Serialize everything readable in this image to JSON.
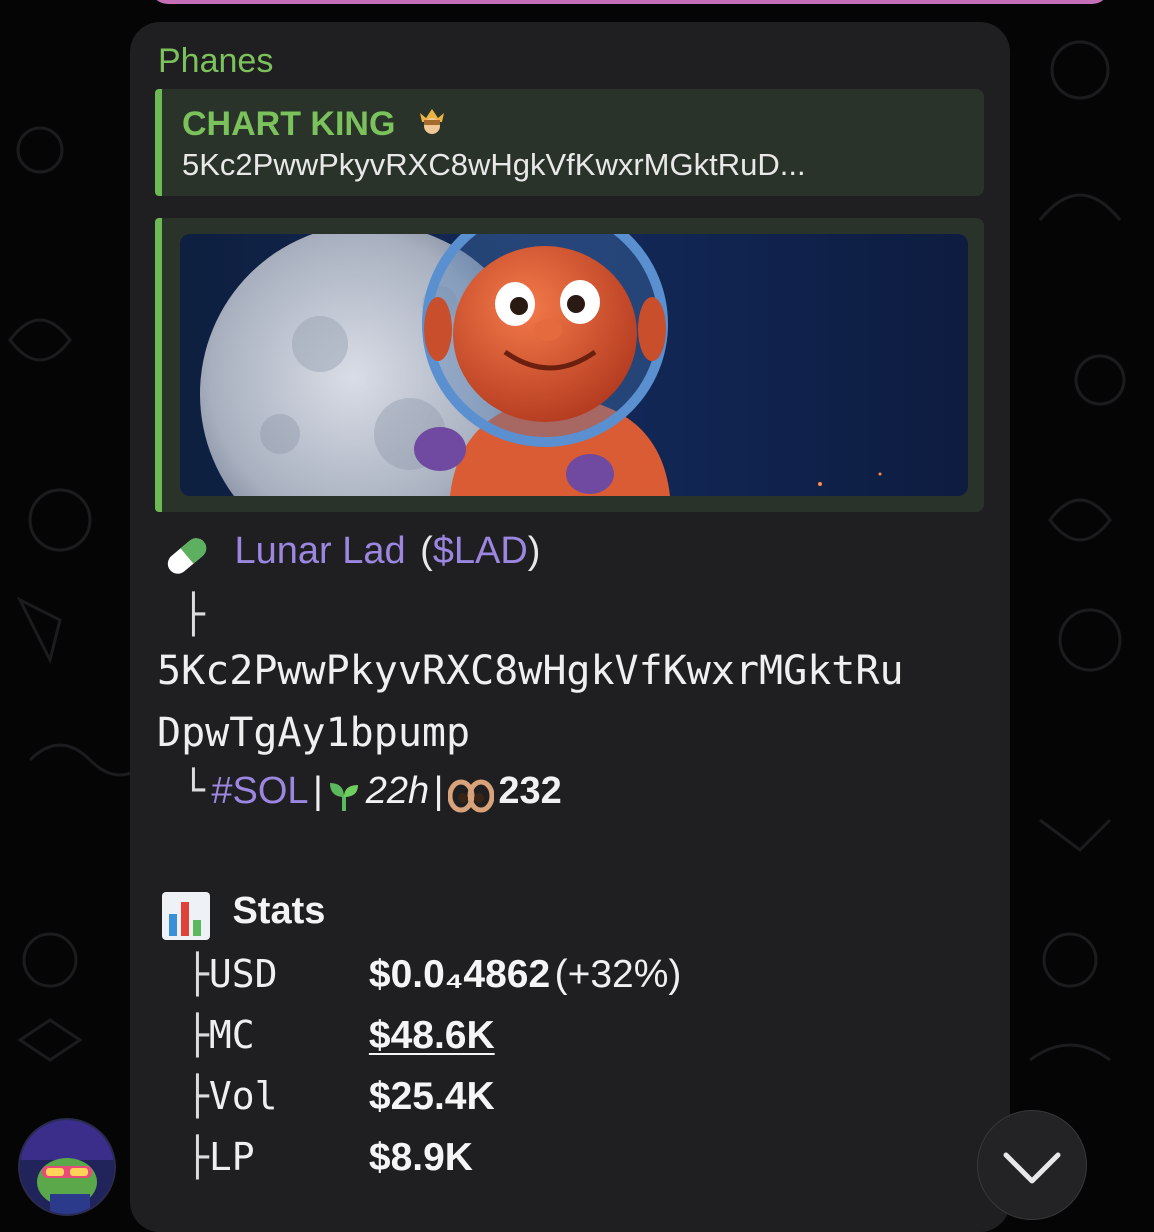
{
  "message": {
    "sender": "Phanes",
    "reply": {
      "title": "CHART KING",
      "text": "5Kc2PwwPkyvRXC8wHgkVfKwxrMGktRuD..."
    },
    "token": {
      "name": "Lunar Lad",
      "ticker_open": "(",
      "ticker": "$LAD",
      "ticker_close": ")",
      "address_branch": "├",
      "address_line1": "5Kc2PwwPkyvRXC8wHgkVfKwxrMGktRu",
      "address_line2": "DpwTgAy1bpump",
      "meta_branch": "└",
      "chain": "#SOL",
      "sep": "|",
      "age": "22h",
      "holders": "232"
    },
    "stats": {
      "title": "Stats",
      "rows": [
        {
          "branch": "├",
          "label": "USD",
          "value": "$0.0₄4862",
          "change": "(+32%)"
        },
        {
          "branch": "├",
          "label": "MC",
          "value": "$48.6K"
        },
        {
          "branch": "├",
          "label": "Vol",
          "value": "$25.4K"
        },
        {
          "branch": "├",
          "label": "LP",
          "value": "$8.9K"
        }
      ]
    }
  },
  "icons": {
    "crown": "crown-icon",
    "pill": "pill-icon",
    "seedling": "seedling-icon",
    "eyes": "eyes-icon",
    "chart": "bar-chart-icon",
    "scroll": "chevron-down-icon"
  },
  "colors": {
    "sender": "#7bc25c",
    "accent_purple": "#9b86e0",
    "bubble": "#1f1f21"
  }
}
